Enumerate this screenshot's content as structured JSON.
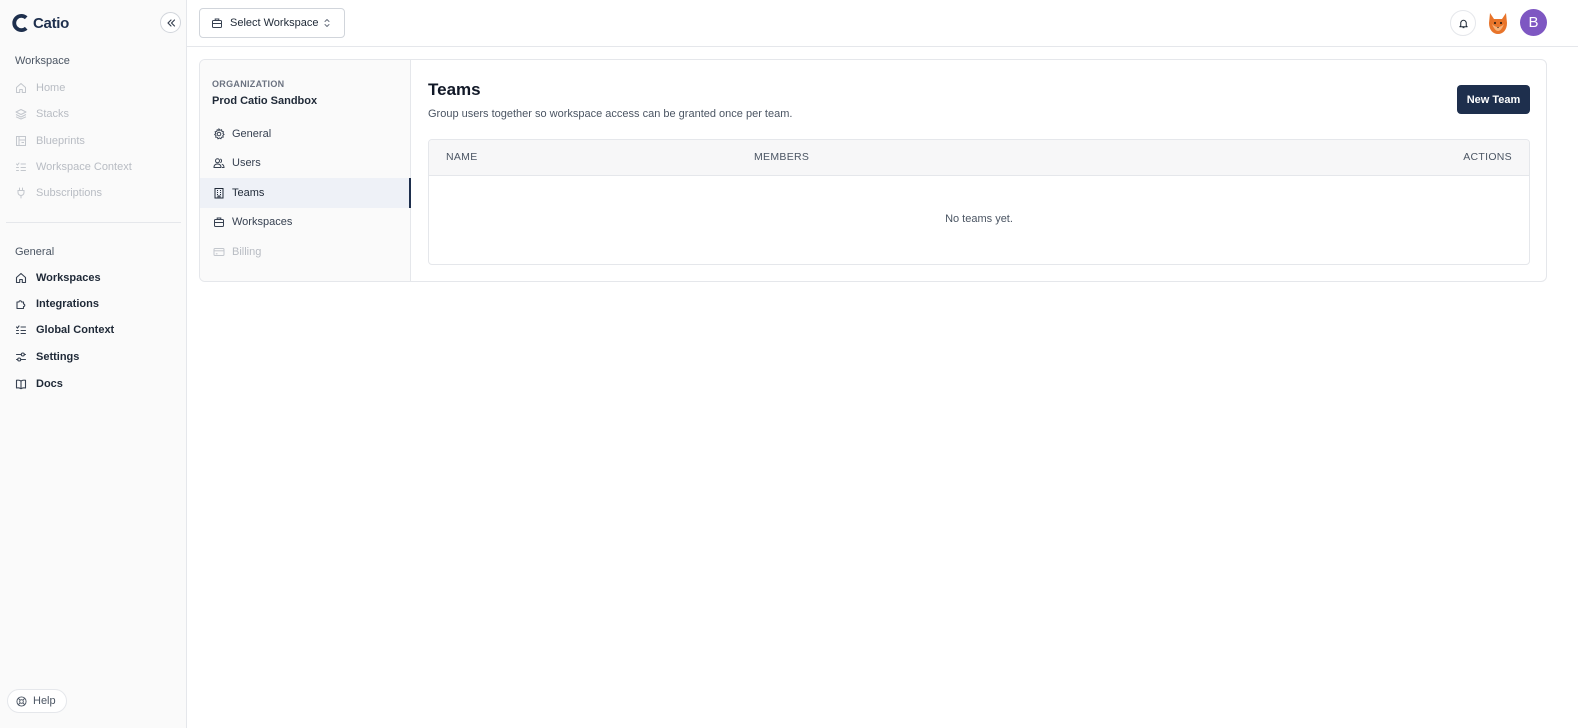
{
  "brand": {
    "name": "Catio",
    "color": "#1e2f4d"
  },
  "sidebar": {
    "workspace_section": "Workspace",
    "workspace_items": [
      {
        "label": "Home",
        "icon": "home-icon",
        "disabled": true
      },
      {
        "label": "Stacks",
        "icon": "layers-icon",
        "disabled": true
      },
      {
        "label": "Blueprints",
        "icon": "blueprint-icon",
        "disabled": true
      },
      {
        "label": "Workspace Context",
        "icon": "context-list-icon",
        "disabled": true
      },
      {
        "label": "Subscriptions",
        "icon": "plug-icon",
        "disabled": true
      }
    ],
    "general_section": "General",
    "general_items": [
      {
        "label": "Workspaces",
        "icon": "home-icon"
      },
      {
        "label": "Integrations",
        "icon": "puzzle-icon"
      },
      {
        "label": "Global Context",
        "icon": "context-list-icon"
      },
      {
        "label": "Settings",
        "icon": "sliders-icon"
      },
      {
        "label": "Docs",
        "icon": "book-icon"
      }
    ],
    "help_label": "Help"
  },
  "topbar": {
    "workspace_select_label": "Select Workspace",
    "user_initial": "B",
    "avatar_color": "#7e57c2"
  },
  "settings_nav": {
    "org_label": "ORGANIZATION",
    "org_name": "Prod Catio Sandbox",
    "items": [
      {
        "label": "General",
        "icon": "gear-icon"
      },
      {
        "label": "Users",
        "icon": "users-icon"
      },
      {
        "label": "Teams",
        "icon": "building-icon",
        "active": true
      },
      {
        "label": "Workspaces",
        "icon": "briefcase-icon"
      },
      {
        "label": "Billing",
        "icon": "credit-card-icon",
        "disabled": true
      }
    ]
  },
  "main": {
    "title": "Teams",
    "subtitle": "Group users together so workspace access can be granted once per team.",
    "new_team_label": "New Team",
    "table": {
      "columns": [
        "NAME",
        "MEMBERS",
        "ACTIONS"
      ],
      "empty_message": "No teams yet."
    }
  }
}
